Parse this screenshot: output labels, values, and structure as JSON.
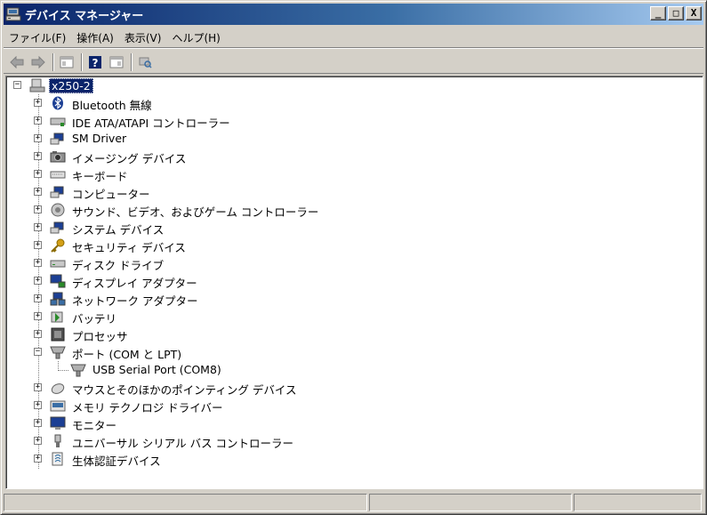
{
  "window": {
    "title": "デバイス マネージャー",
    "buttons": [
      "_",
      "□",
      "X"
    ]
  },
  "menu": [
    "ファイル(F)",
    "操作(A)",
    "表示(V)",
    "ヘルプ(H)"
  ],
  "toolbar": {
    "icons": [
      "back-icon",
      "forward-icon",
      "properties-icon",
      "help-icon",
      "view-icon",
      "scan-hardware-icon"
    ]
  },
  "tree": {
    "root": {
      "label": "x250-2",
      "expander": "−",
      "icon": "computer-icon"
    },
    "items": [
      {
        "label": "Bluetooth 無線",
        "icon": "bluetooth-icon",
        "expander": "+"
      },
      {
        "label": "IDE ATA/ATAPI コントローラー",
        "icon": "ide-controller-icon",
        "expander": "+"
      },
      {
        "label": "SM Driver",
        "icon": "sm-driver-icon",
        "expander": "+"
      },
      {
        "label": "イメージング デバイス",
        "icon": "camera-icon",
        "expander": "+"
      },
      {
        "label": "キーボード",
        "icon": "keyboard-icon",
        "expander": "+"
      },
      {
        "label": "コンピューター",
        "icon": "computer-icon",
        "expander": "+"
      },
      {
        "label": "サウンド、ビデオ、およびゲーム コントローラー",
        "icon": "speaker-icon",
        "expander": "+"
      },
      {
        "label": "システム デバイス",
        "icon": "system-icon",
        "expander": "+"
      },
      {
        "label": "セキュリティ デバイス",
        "icon": "key-icon",
        "expander": "+"
      },
      {
        "label": "ディスク ドライブ",
        "icon": "disk-icon",
        "expander": "+"
      },
      {
        "label": "ディスプレイ アダプター",
        "icon": "display-icon",
        "expander": "+"
      },
      {
        "label": "ネットワーク アダプター",
        "icon": "network-icon",
        "expander": "+"
      },
      {
        "label": "バッテリ",
        "icon": "battery-icon",
        "expander": "+"
      },
      {
        "label": "プロセッサ",
        "icon": "processor-icon",
        "expander": "+"
      },
      {
        "label": "ポート (COM と LPT)",
        "icon": "port-icon",
        "expander": "−",
        "children": [
          {
            "label": "USB Serial Port (COM8)",
            "icon": "port-icon"
          }
        ]
      },
      {
        "label": "マウスとそのほかのポインティング デバイス",
        "icon": "mouse-icon",
        "expander": "+"
      },
      {
        "label": "メモリ テクノロジ ドライバー",
        "icon": "memory-icon",
        "expander": "+"
      },
      {
        "label": "モニター",
        "icon": "monitor-icon",
        "expander": "+"
      },
      {
        "label": "ユニバーサル シリアル バス コントローラー",
        "icon": "usb-icon",
        "expander": "+"
      },
      {
        "label": "生体認証デバイス",
        "icon": "biometric-icon",
        "expander": "+"
      }
    ]
  },
  "colors": {
    "title_start": "#0a246a",
    "title_end": "#a6caf0",
    "selection": "#0a246a",
    "face": "#d4d0c8"
  }
}
